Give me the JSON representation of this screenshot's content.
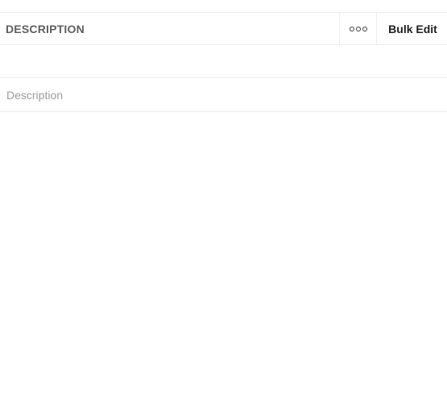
{
  "header": {
    "title": "DESCRIPTION",
    "more_icon": "more-horizontal-icon",
    "bulk_edit_label": "Bulk Edit"
  },
  "description_field": {
    "value": "",
    "placeholder": "Description"
  },
  "colors": {
    "border": "#ececec",
    "header_text": "#5f5f5f",
    "placeholder": "#9b9b9b"
  }
}
